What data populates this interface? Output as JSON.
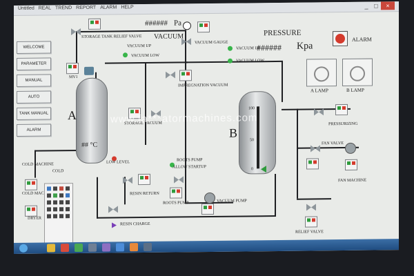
{
  "window": {
    "top_tabs": [
      "Untitled",
      "REAL",
      "TREND",
      "REPORT",
      "ALARM",
      "HELP"
    ],
    "controls": [
      "_",
      "□",
      "×"
    ]
  },
  "nav": {
    "buttons": [
      "WELCOME",
      "PARAMETER",
      "MANUAL",
      "AUTO",
      "TANK MANUAL",
      "ALARM"
    ]
  },
  "readouts": {
    "vacuum_value": "######",
    "vacuum_unit": "Pa",
    "vacuum_label": "VACUUM",
    "pressure_title": "PRESSURE",
    "pressure_value": "######",
    "pressure_unit": "Kpa",
    "temperature": "## °C"
  },
  "labels": {
    "storage_tank_relief_valve": "STORAGE TANK RELIEF VALVE",
    "vacuum_up_top": "VACUUM UP",
    "vacuum_low_top": "VACUUM LOW",
    "vacuum_gauge": "VACUUM GAUGE",
    "vacuum_up_right": "VACUUM UP",
    "vacuum_low_right": "VACUUM LOW",
    "mv1": "MV1",
    "impregnation_vacuum": "IMPREGNATION VACUUM",
    "storage_vacuum": "STORAGE VACUUM",
    "tank_a": "A",
    "tank_b": "B",
    "low_level": "LOW LEVEL",
    "cold_machine": "COLD MACHINE",
    "cold": "COLD",
    "cold_machine2": "COLD MACHINE",
    "dryer": "DRYER",
    "resin_return": "RESIN RETURN",
    "roots_pump_allow": "ROOTS PUMP",
    "allow_startup": "ALLOW STARTUP",
    "roots_pump": "ROOTS PUMP",
    "vacuum_pump": "VACUUM PUMP",
    "resin_charge": "RESIN CHARGE",
    "alarm": "ALARM",
    "a_lamp": "A LAMP",
    "b_lamp": "B LAMP",
    "pressurizing": "PRESSURIZING",
    "fan_valve": "FAN VALVE",
    "fan_machine": "FAN MACHINE",
    "relief_valve": "RELIEF VALVE",
    "scale_100": "100",
    "scale_50": "50",
    "scale_0": "0"
  },
  "watermark": "www.fa***atormachines.com",
  "colors": {
    "screen_bg": "#e9ebe8",
    "pipe": "#1e1f22",
    "valve": "#8e969b",
    "led_green": "#38b54a",
    "led_red": "#d43b2d",
    "taskbar": "#2a5b92"
  }
}
